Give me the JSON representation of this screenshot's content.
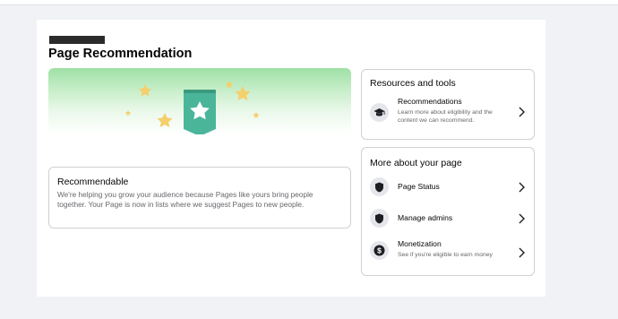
{
  "header": {
    "title": "Page Recommendation"
  },
  "hero": {
    "badge_color": "#4bb59a",
    "star_color": "#f5cf6b"
  },
  "recommendable": {
    "title": "Recommendable",
    "text": "We're helping you grow your audience because Pages like yours bring people together. Your Page is now in lists where we suggest Pages to new people."
  },
  "resources": {
    "title": "Resources and tools",
    "items": [
      {
        "label": "Recommendations",
        "sub": "Learn more about eligibility and the content we can recommend.",
        "icon": "graduation-cap-icon"
      }
    ]
  },
  "more": {
    "title": "More about your page",
    "items": [
      {
        "label": "Page Status",
        "icon": "shield-icon"
      },
      {
        "label": "Manage admins",
        "icon": "shield-icon"
      },
      {
        "label": "Monetization",
        "sub": "See if you're eligible to earn money",
        "icon": "dollar-coin-icon"
      }
    ]
  }
}
